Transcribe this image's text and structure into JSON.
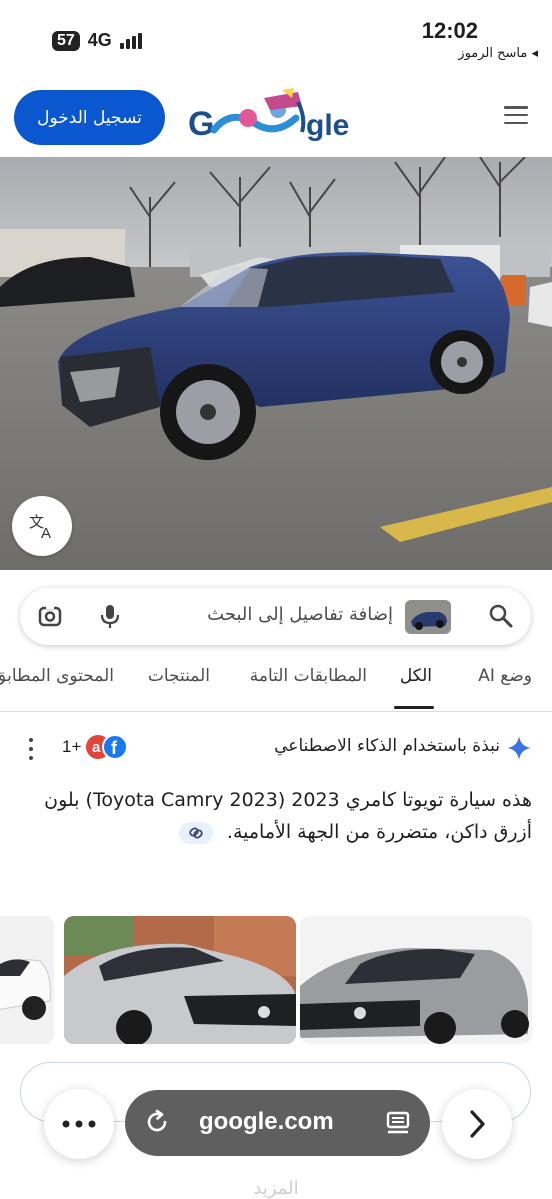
{
  "status_bar": {
    "sim_badge": "57",
    "network": "4G",
    "time": "12:02",
    "back_app": "◂ ماسح الرموز"
  },
  "header": {
    "signin_label": "تسجيل الدخول",
    "logo_text_left": "G",
    "logo_text_right": "gle",
    "menu_icon": "hamburger-icon"
  },
  "search": {
    "placeholder": "إضافة تفاصيل إلى البحث",
    "icons": [
      "lens-icon",
      "mic-icon",
      "search-icon"
    ]
  },
  "tabs": [
    {
      "label": "وضع AI",
      "active": false
    },
    {
      "label": "الكل",
      "active": true
    },
    {
      "label": "المطابقات التامة",
      "active": false
    },
    {
      "label": "المنتجات",
      "active": false
    },
    {
      "label": "المحتوى المطابق",
      "active": false
    }
  ],
  "ai_overview": {
    "title": "نبذة باستخدام الذكاء الاصطناعي",
    "source_count": "1+",
    "text": "هذه سيارة تويوتا كامري 2023 (Toyota Camry 2023) بلون أزرق داكن، متضررة من الجهة الأمامية."
  },
  "browser_bar": {
    "url": "google.com"
  },
  "footer_fade": "المزيد"
}
